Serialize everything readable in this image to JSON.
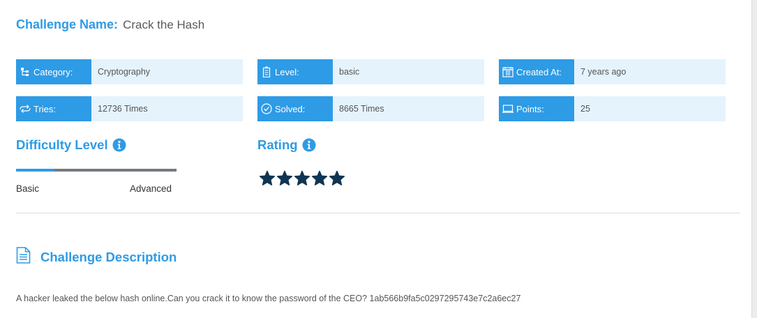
{
  "challenge": {
    "name_label": "Challenge Name:",
    "name_value": "Crack the Hash"
  },
  "info": {
    "category": {
      "label": "Category:",
      "value": "Cryptography",
      "icon": "sitemap-icon"
    },
    "level": {
      "label": "Level:",
      "value": "basic",
      "icon": "battery-icon"
    },
    "created": {
      "label": "Created At:",
      "value": "7 years ago",
      "icon": "calendar-icon"
    },
    "tries": {
      "label": "Tries:",
      "value": "12736 Times",
      "icon": "exchange-icon"
    },
    "solved": {
      "label": "Solved:",
      "value": "8665 Times",
      "icon": "check-circle-icon"
    },
    "points": {
      "label": "Points:",
      "value": "25",
      "icon": "laptop-icon"
    }
  },
  "difficulty": {
    "title": "Difficulty Level",
    "level_fraction": 0.24,
    "min_label": "Basic",
    "max_label": "Advanced"
  },
  "rating": {
    "title": "Rating",
    "stars": 5,
    "max_stars": 5
  },
  "description": {
    "title": "Challenge Description",
    "text": "A hacker leaked the below hash online.Can you crack it to know the password of the CEO? 1ab566b9fa5c0297295743e7c2a6ec27"
  },
  "colors": {
    "accent": "#2e9be6",
    "value_bg": "#e5f3fd",
    "star": "#0f3554",
    "bar_track": "#757980"
  }
}
